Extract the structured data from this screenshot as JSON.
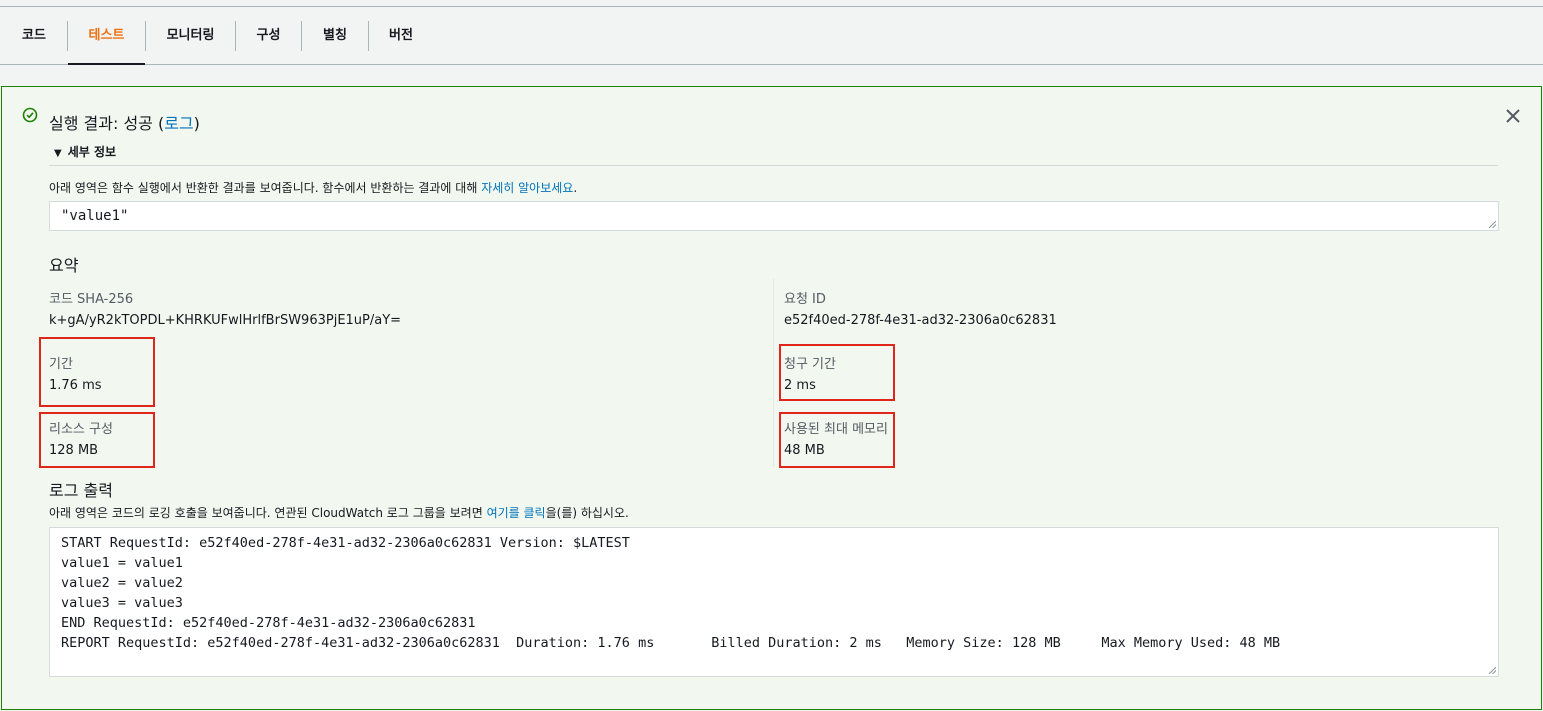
{
  "tabs": [
    {
      "label": "코드",
      "active": false
    },
    {
      "label": "테스트",
      "active": true
    },
    {
      "label": "모니터링",
      "active": false
    },
    {
      "label": "구성",
      "active": false
    },
    {
      "label": "별칭",
      "active": false
    },
    {
      "label": "버전",
      "active": false
    }
  ],
  "result": {
    "title_prefix": "실행 결과: 성공 (",
    "title_link": "로그",
    "title_suffix": ")",
    "details_toggle": "세부 정보",
    "description_prefix": "아래 영역은 함수 실행에서 반환한 결과를 보여줍니다. 함수에서 반환하는 결과에 대해 ",
    "description_link": "자세히 알아보세요",
    "description_suffix": ".",
    "return_value": "\"value1\""
  },
  "summary": {
    "heading": "요약",
    "code_sha_label": "코드 SHA-256",
    "code_sha_value": "k+gA/yR2kTOPDL+KHRKUFwlHrlfBrSW963PjE1uP/aY=",
    "request_id_label": "요청 ID",
    "request_id_value": "e52f40ed-278f-4e31-ad32-2306a0c62831",
    "duration_label": "기간",
    "duration_value": "1.76 ms",
    "billed_label": "청구 기간",
    "billed_value": "2 ms",
    "resources_label": "리소스 구성",
    "resources_value": "128 MB",
    "max_memory_label": "사용된 최대 메모리",
    "max_memory_value": "48 MB"
  },
  "log": {
    "heading": "로그 출력",
    "description_prefix": "아래 영역은 코드의 로깅 호출을 보여줍니다. 연관된 CloudWatch 로그 그룹을 보려면 ",
    "description_link": "여기를 클릭",
    "description_suffix": "을(를) 하십시오.",
    "lines": [
      "START RequestId: e52f40ed-278f-4e31-ad32-2306a0c62831 Version: $LATEST",
      "value1 = value1",
      "value2 = value2",
      "value3 = value3",
      "END RequestId: e52f40ed-278f-4e31-ad32-2306a0c62831",
      "REPORT RequestId: e52f40ed-278f-4e31-ad32-2306a0c62831  Duration: 1.76 ms       Billed Duration: 2 ms   Memory Size: 128 MB     Max Memory Used: 48 MB"
    ]
  },
  "colors": {
    "active_tab": "#ec7211",
    "success": "#1d8102",
    "link": "#0073bb",
    "highlight": "#e0261a"
  },
  "icons": {
    "status": "success-check-icon",
    "close": "close-icon",
    "toggle": "caret-down-icon"
  }
}
